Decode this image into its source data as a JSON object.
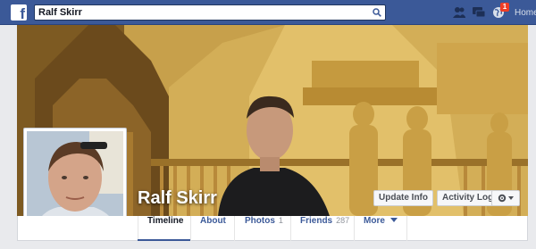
{
  "header": {
    "search_value": "Ralf Skirr",
    "home_label": "Home",
    "notification_count": "1"
  },
  "profile": {
    "name": "Ralf Skirr",
    "update_info_label": "Update Info",
    "activity_log_label": "Activity Log"
  },
  "nav": {
    "timeline": "Timeline",
    "about": "About",
    "photos": "Photos",
    "photos_count": "1",
    "friends": "Friends",
    "friends_count": "287",
    "more": "More"
  },
  "colors": {
    "brand_blue": "#3b5998",
    "badge_red": "#f03d25"
  }
}
